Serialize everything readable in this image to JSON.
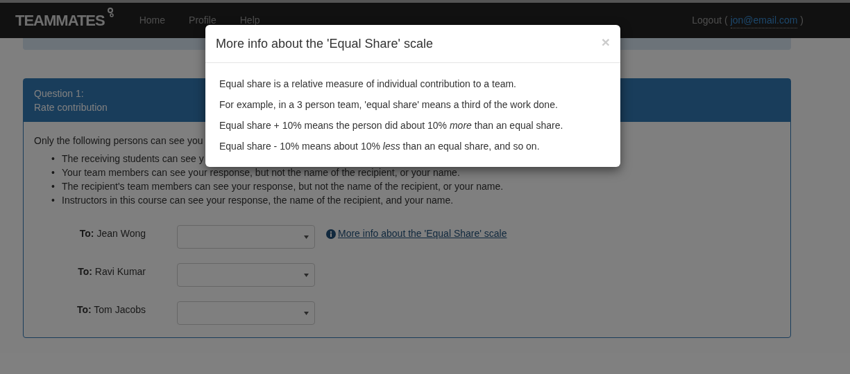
{
  "navbar": {
    "brand": "TEAMMATES",
    "links": [
      {
        "label": "Home"
      },
      {
        "label": "Profile"
      },
      {
        "label": "Help"
      }
    ],
    "logout": {
      "label": "Logout (",
      "email": "jon@email.com",
      "close": ")"
    }
  },
  "question": {
    "number": "Question 1:",
    "title": "Rate contribution",
    "bullet": "•",
    "visibility_intro": "Only the following persons can see you",
    "visibility": [
      "The receiving students can see y",
      "Your team members can see your response, but not the name of the recipient, or your name.",
      "The recipient's team members can see your response, but not the name of the recipient, or your name.",
      "Instructors in this course can see your response, the name of the recipient, and your name."
    ],
    "recipients": [
      {
        "to": "To:",
        "name": "Jean Wong"
      },
      {
        "to": "To:",
        "name": "Ravi Kumar"
      },
      {
        "to": "To:",
        "name": "Tom Jacobs"
      }
    ],
    "info_link": "More info about the 'Equal Share' scale"
  },
  "modal": {
    "title": "More info about the 'Equal Share' scale",
    "close": "×",
    "paragraphs": [
      "Equal share is a relative measure of individual contribution to a team.",
      "For example, in a 3 person team, 'equal share' means a third of the work done.",
      "Equal share + 10% means the person did about 10% *more* than an equal share.",
      "Equal share - 10% means about 10% *less* than an equal share, and so on."
    ]
  }
}
